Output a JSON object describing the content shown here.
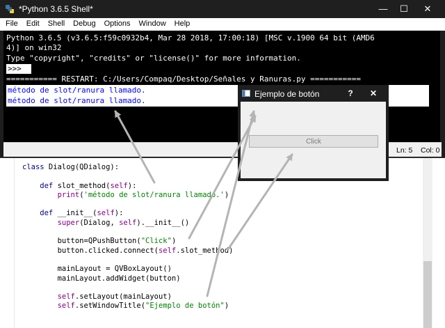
{
  "shell": {
    "title": "*Python 3.6.5 Shell*",
    "menu": [
      "File",
      "Edit",
      "Shell",
      "Debug",
      "Options",
      "Window",
      "Help"
    ],
    "banner_lines": [
      "Python 3.6.5 (v3.6.5:f59c0932b4, Mar 28 2018, 17:00:18) [MSC v.1900 64 bit (AMD6",
      "4)] on win32",
      "Type \"copyright\", \"credits\" or \"license()\" for more information."
    ],
    "prompt": ">>>",
    "restart_line": "=========== RESTART: C:/Users/Compaq/Desktop/Señales y Ranuras.py ===========",
    "output_lines": [
      "método de slot/ranura llamado.",
      "método de slot/ranura llamado."
    ],
    "status": {
      "ln": "Ln: 5",
      "col": "Col: 0"
    },
    "window_buttons": {
      "minimize": "—",
      "maximize": "☐",
      "close": "✕"
    }
  },
  "dialog": {
    "title": "Ejemplo de botón",
    "help_label": "?",
    "close_label": "✕",
    "button_label": "Click"
  },
  "code": {
    "l1a": "class",
    "l1b": " Dialog(QDialog):",
    "l3a": "    def",
    "l3b": " slot_method(",
    "l3c": "self",
    "l3d": "):",
    "l4a": "        ",
    "l4b": "print",
    "l4c": "(",
    "l4d": "'método de slot/ranura llamado.'",
    "l4e": ")",
    "l6a": "    def",
    "l6b": " __init__(",
    "l6c": "self",
    "l6d": "):",
    "l7a": "        ",
    "l7b": "super",
    "l7c": "(Dialog, ",
    "l7d": "self",
    "l7e": ").__init__()",
    "l9a": "        button=QPushButton(",
    "l9b": "\"Click\"",
    "l9c": ")",
    "l10a": "        button.clicked.connect(",
    "l10b": "self",
    "l10c": ".slot_method)",
    "l12": "        mainLayout = QVBoxLayout()",
    "l13": "        mainLayout.addWidget(button)",
    "l15a": "        ",
    "l15b": "self",
    "l15c": ".setLayout(mainLayout)",
    "l16a": "        ",
    "l16b": "self",
    "l16c": ".setWindowTitle(",
    "l16d": "\"Ejemplo de botón\"",
    "l16e": ")"
  },
  "colors": {
    "titlebar": "#1f1f1f",
    "keyword": "#000080",
    "builtin": "#800080",
    "string": "#008000",
    "output": "#0000ff"
  }
}
